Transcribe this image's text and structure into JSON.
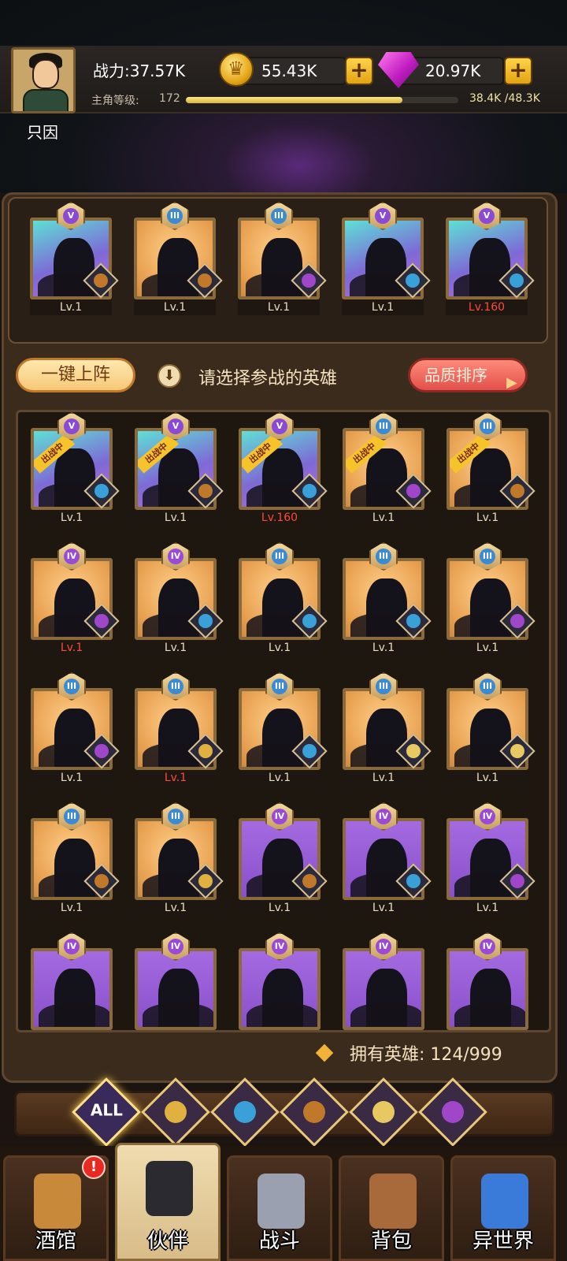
{
  "player": {
    "name": "只因",
    "power_label": "战力:37.57K",
    "gold": "55.43K",
    "gems": "20.97K",
    "level_label": "主角等级:",
    "level": "172",
    "exp_text": "38.4K /48.3K",
    "exp_fraction": 0.795
  },
  "lineup": [
    {
      "rank": "V",
      "level": "Lv.1",
      "faction": "lion-icon",
      "red": false
    },
    {
      "rank": "III",
      "level": "Lv.1",
      "faction": "lion-icon",
      "red": false
    },
    {
      "rank": "III",
      "level": "Lv.1",
      "faction": "demon-icon",
      "red": false
    },
    {
      "rank": "V",
      "level": "Lv.1",
      "faction": "fish-icon",
      "red": false
    },
    {
      "rank": "V",
      "level": "Lv.160",
      "faction": "fish-icon",
      "red": true
    }
  ],
  "actions": {
    "quick_deploy": "一键上阵",
    "hint": "请选择参战的英雄",
    "sort": "品质排序"
  },
  "roster": [
    {
      "rank": "V",
      "level": "Lv.1",
      "faction": "fish",
      "ribbon": "出战中",
      "bg": "v",
      "red": false
    },
    {
      "rank": "V",
      "level": "Lv.1",
      "faction": "lion",
      "ribbon": "出战中",
      "bg": "v",
      "red": false
    },
    {
      "rank": "V",
      "level": "Lv.160",
      "faction": "fish",
      "ribbon": "出战中",
      "bg": "v",
      "red": true
    },
    {
      "rank": "III",
      "level": "Lv.1",
      "faction": "demon",
      "ribbon": "出战中",
      "bg": "iii",
      "red": false
    },
    {
      "rank": "III",
      "level": "Lv.1",
      "faction": "lion",
      "ribbon": "出战中",
      "bg": "iii",
      "red": false
    },
    {
      "rank": "IV",
      "level": "Lv.1",
      "faction": "demon",
      "ribbon": "",
      "bg": "iii",
      "red": true
    },
    {
      "rank": "IV",
      "level": "Lv.1",
      "faction": "fish",
      "ribbon": "",
      "bg": "iii",
      "red": false
    },
    {
      "rank": "III",
      "level": "Lv.1",
      "faction": "fish",
      "ribbon": "",
      "bg": "iii",
      "red": false
    },
    {
      "rank": "III",
      "level": "Lv.1",
      "faction": "fish",
      "ribbon": "",
      "bg": "iii",
      "red": false
    },
    {
      "rank": "III",
      "level": "Lv.1",
      "faction": "demon",
      "ribbon": "",
      "bg": "iii",
      "red": false
    },
    {
      "rank": "III",
      "level": "Lv.1",
      "faction": "demon",
      "ribbon": "",
      "bg": "iii",
      "red": false
    },
    {
      "rank": "III",
      "level": "Lv.1",
      "faction": "knight",
      "ribbon": "",
      "bg": "iii",
      "red": true
    },
    {
      "rank": "III",
      "level": "Lv.1",
      "faction": "fish",
      "ribbon": "",
      "bg": "iii",
      "red": false
    },
    {
      "rank": "III",
      "level": "Lv.1",
      "faction": "elf",
      "ribbon": "",
      "bg": "iii",
      "red": false
    },
    {
      "rank": "III",
      "level": "Lv.1",
      "faction": "elf",
      "ribbon": "",
      "bg": "iii",
      "red": false
    },
    {
      "rank": "III",
      "level": "Lv.1",
      "faction": "lion",
      "ribbon": "",
      "bg": "iii",
      "red": false
    },
    {
      "rank": "III",
      "level": "Lv.1",
      "faction": "knight",
      "ribbon": "",
      "bg": "iii",
      "red": false
    },
    {
      "rank": "IV",
      "level": "Lv.1",
      "faction": "lion",
      "ribbon": "",
      "bg": "iv",
      "red": false
    },
    {
      "rank": "IV",
      "level": "Lv.1",
      "faction": "fish",
      "ribbon": "",
      "bg": "iv",
      "red": false
    },
    {
      "rank": "IV",
      "level": "Lv.1",
      "faction": "demon",
      "ribbon": "",
      "bg": "iv",
      "red": false
    },
    {
      "rank": "IV",
      "level": "",
      "faction": "",
      "ribbon": "",
      "bg": "iv",
      "red": false
    },
    {
      "rank": "IV",
      "level": "",
      "faction": "",
      "ribbon": "",
      "bg": "iv",
      "red": false
    },
    {
      "rank": "IV",
      "level": "",
      "faction": "",
      "ribbon": "",
      "bg": "iv",
      "red": false
    },
    {
      "rank": "IV",
      "level": "",
      "faction": "",
      "ribbon": "",
      "bg": "iv",
      "red": false
    },
    {
      "rank": "IV",
      "level": "",
      "faction": "",
      "ribbon": "",
      "bg": "iv",
      "red": false
    }
  ],
  "owned_text": "拥有英雄: 124/999",
  "filters": [
    {
      "name": "filter-all",
      "label": "ALL",
      "color": "#3a2a5a"
    },
    {
      "name": "filter-knight-icon",
      "color": "#e0b040"
    },
    {
      "name": "filter-fish-icon",
      "color": "#3aa0d8"
    },
    {
      "name": "filter-lion-icon",
      "color": "#c0782a"
    },
    {
      "name": "filter-elf-icon",
      "color": "#e8c860"
    },
    {
      "name": "filter-demon-icon",
      "color": "#a046c8"
    }
  ],
  "nav": [
    {
      "label": "酒馆",
      "icon": "beer-mug-icon",
      "active": false,
      "alert": "!"
    },
    {
      "label": "伙伴",
      "icon": "partner-icon",
      "active": true
    },
    {
      "label": "战斗",
      "icon": "crossed-swords-icon",
      "active": false
    },
    {
      "label": "背包",
      "icon": "backpack-icon",
      "active": false
    },
    {
      "label": "异世界",
      "icon": "portal-icon",
      "active": false
    }
  ]
}
